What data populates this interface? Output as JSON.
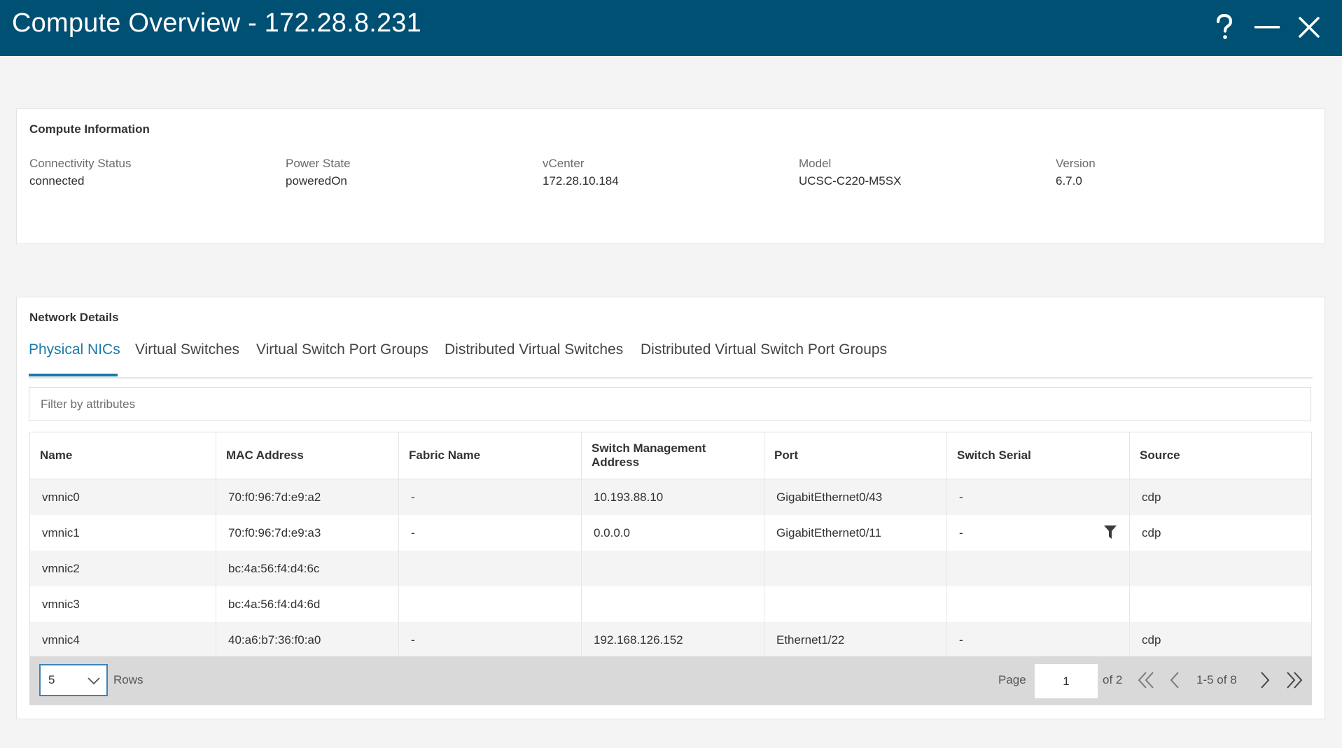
{
  "window": {
    "title": "Compute Overview - 172.28.8.231",
    "icons": [
      "help-icon",
      "minimize-icon",
      "close-icon"
    ]
  },
  "compute_info": {
    "title": "Compute Information",
    "fields": [
      {
        "label": "Connectivity Status",
        "value": "connected"
      },
      {
        "label": "Power State",
        "value": "poweredOn"
      },
      {
        "label": "vCenter",
        "value": "172.28.10.184"
      },
      {
        "label": "Model",
        "value": "UCSC-C220-M5SX"
      },
      {
        "label": "Version",
        "value": "6.7.0"
      }
    ]
  },
  "network": {
    "title": "Network Details",
    "tabs": [
      {
        "label": "Physical NICs",
        "active": true
      },
      {
        "label": "Virtual Switches",
        "active": false
      },
      {
        "label": "Virtual Switch Port Groups",
        "active": false
      },
      {
        "label": "Distributed Virtual Switches",
        "active": false
      },
      {
        "label": "Distributed Virtual Switch Port Groups",
        "active": false
      }
    ],
    "filter_placeholder": "Filter by attributes",
    "table": {
      "columns": [
        "Name",
        "MAC Address",
        "Fabric Name",
        "Switch Management Address",
        "Port",
        "Switch Serial",
        "Source"
      ],
      "rows": [
        [
          "vmnic0",
          "70:f0:96:7d:e9:a2",
          "-",
          "10.193.88.10",
          "GigabitEthernet0/43",
          "-",
          "cdp"
        ],
        [
          "vmnic1",
          "70:f0:96:7d:e9:a3",
          "-",
          "0.0.0.0",
          "GigabitEthernet0/11",
          "-",
          "cdp"
        ],
        [
          "vmnic2",
          "bc:4a:56:f4:d4:6c",
          "",
          "",
          "",
          "",
          ""
        ],
        [
          "vmnic3",
          "bc:4a:56:f4:d4:6d",
          "",
          "",
          "",
          "",
          ""
        ],
        [
          "vmnic4",
          "40:a6:b7:36:f0:a0",
          "-",
          "192.168.126.152",
          "Ethernet1/22",
          "-",
          "cdp"
        ]
      ]
    },
    "pagination": {
      "rows_per_page": "5",
      "rows_label": "Rows",
      "page_label": "Page",
      "current_page": "1",
      "of_label": "of  2",
      "range_label": "1-5 of 8"
    }
  },
  "colors": {
    "titlebar": "#005073",
    "accent": "#1b7aa8",
    "select_border": "#3d83b9"
  }
}
